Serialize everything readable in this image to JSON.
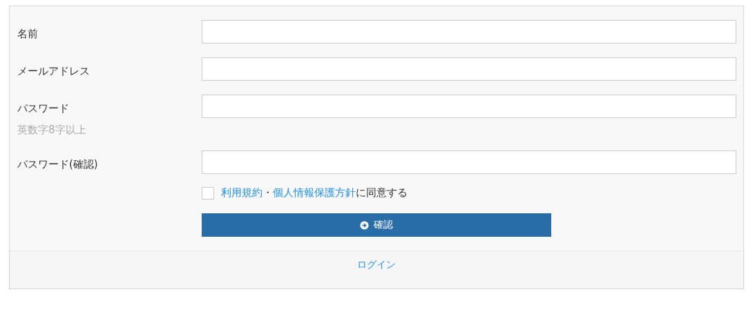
{
  "fields": [
    {
      "label": "名前"
    },
    {
      "label": "メールアドレス"
    },
    {
      "label": "パスワード",
      "hint": "英数字8字以上"
    },
    {
      "label": "パスワード(確認)"
    }
  ],
  "agreement": {
    "checked": false,
    "parts": [
      {
        "kind": "link",
        "text": "利用規約"
      },
      {
        "kind": "text",
        "text": "・"
      },
      {
        "kind": "link",
        "text": "個人情報保護方針"
      },
      {
        "kind": "text",
        "text": "に同意する"
      }
    ]
  },
  "submit": {
    "label": "確認"
  },
  "footer": {
    "link": "ログイン"
  }
}
